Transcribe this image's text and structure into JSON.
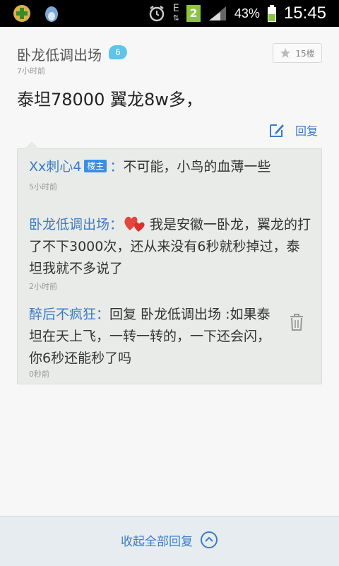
{
  "status_bar": {
    "network": "E",
    "sim": "2",
    "battery": "43%",
    "time": "15:45"
  },
  "post": {
    "author": "卧龙低调出场",
    "level": "6",
    "time": "7小时前",
    "floor": "15楼",
    "body": "泰坦78000 翼龙8w多，",
    "reply_label": "回复"
  },
  "replies": [
    {
      "name": "Xx刺心4",
      "badge": "楼主",
      "colon": "：",
      "text": "不可能，小鸟的血薄一些",
      "time": "5小时前"
    },
    {
      "name": "卧龙低调出场：",
      "text": "我是安徽一卧龙，翼龙的打了不下3000次，还从来没有6秒就秒掉过，泰坦我就不多说了",
      "time": "2小时前"
    },
    {
      "name": "醉后不疯狂：",
      "text": "回复 卧龙低调出场 :如果泰坦在天上飞，一转一转的，一下还会闪，你6秒还能秒了吗",
      "time": "0秒前"
    }
  ],
  "footer": {
    "collapse_label": "收起全部回复"
  }
}
